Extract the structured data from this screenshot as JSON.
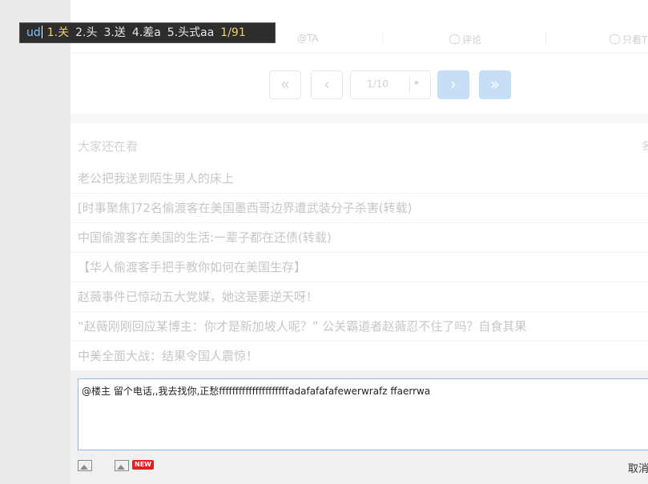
{
  "actions": {
    "at_ta": "@TA",
    "comment": "评论",
    "only_op": "只看T"
  },
  "pager": {
    "first": "«",
    "prev": "‹",
    "page": "1/10",
    "go": "▸",
    "next": "›",
    "last": "»"
  },
  "recommended": {
    "title": "大家还在看",
    "more": "名",
    "items": [
      "老公把我送到陌生男人的床上",
      "[时事聚焦]72名偷渡客在美国墨西哥边界遭武装分子杀害(转载)",
      "中国偷渡客在美国的生活:一辈子都在还债(转载)",
      "【华人偷渡客手把手教你如何在美国生存】",
      "赵薇事件已惊动五大党媒，她这是要逆天呀！",
      "“赵薇刚刚回应某博主：你才是新加坡人呢？” 公关霸道者赵薇忍不住了吗？自食其果",
      "中美全面大战：结果令国人震惊！"
    ]
  },
  "editor": {
    "text": "@楼主  留个电话,,我去找你,正愁fffffffffffffffffffffadafafafafewerwrafz  ffaerrwa",
    "new_badge": "NEW",
    "cancel": "取消"
  },
  "ime": {
    "input": "ud",
    "candidates": [
      "1.关",
      "2.头",
      "3.送",
      "4.差a",
      "5.头式aa"
    ],
    "page": "1/91"
  },
  "colors": {
    "accent_disabled": "#c7def7",
    "editor_border": "#8fb8e6",
    "badge_red": "#e02020"
  }
}
